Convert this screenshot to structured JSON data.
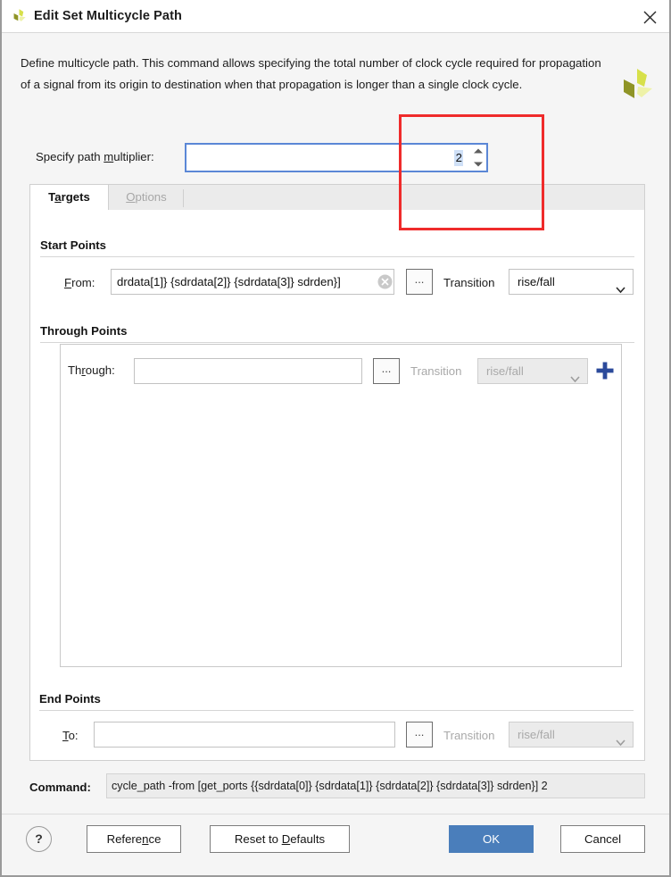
{
  "window": {
    "title": "Edit Set Multicycle Path",
    "icon": "vivado-logo-icon",
    "close_icon": "close-icon"
  },
  "description": "Define multicycle path. This command allows specifying the total number of clock cycle required for propagation of a signal from its origin to destination when that propagation is longer than a single clock cycle.",
  "brand": {
    "logo_icon": "xilinx-vivado-logo-icon",
    "colors": [
      "#d7e04a",
      "#8f9426",
      "#eef2a8"
    ]
  },
  "multiplier": {
    "label_before": "Specify path ",
    "label_mnemonic": "m",
    "label_after": "ultiplier:",
    "value": "2",
    "value_selected": true,
    "spin_up_icon": "spin-up-icon",
    "spin_down_icon": "spin-down-icon"
  },
  "annotation": {
    "color": "#ef2b2b",
    "shape": "rectangle"
  },
  "tabs": [
    {
      "label_before": "T",
      "label_mnemonic": "a",
      "label_after": "rgets",
      "label": "Targets",
      "active": true,
      "disabled": false
    },
    {
      "label_before": "",
      "label_mnemonic": "O",
      "label_after": "ptions",
      "label": "Options",
      "active": false,
      "disabled": true
    }
  ],
  "start_points": {
    "group_title": "Start Points",
    "from": {
      "label_before": "",
      "label_mnemonic": "F",
      "label_after": "rom:",
      "value": "drdata[1]} {sdrdata[2]} {sdrdata[3]} sdrden}]",
      "clear_icon": "clear-circle-icon",
      "browse_label": "...",
      "transition_label": "Transition",
      "transition_value": "rise/fall",
      "transition_disabled": false,
      "chevron_icon": "chevron-down-icon"
    }
  },
  "through_points": {
    "group_title": "Through Points",
    "through": {
      "label_before": "Th",
      "label_mnemonic": "r",
      "label_after": "ough:",
      "value": "",
      "browse_label": "...",
      "transition_label": "Transition",
      "transition_value": "rise/fall",
      "transition_disabled": true,
      "chevron_icon": "chevron-down-icon",
      "add_icon": "plus-icon"
    }
  },
  "end_points": {
    "group_title": "End Points",
    "to": {
      "label_before": "",
      "label_mnemonic": "T",
      "label_after": "o:",
      "value": "",
      "browse_label": "...",
      "transition_label": "Transition",
      "transition_value": "rise/fall",
      "transition_disabled": true,
      "chevron_icon": "chevron-down-icon"
    }
  },
  "command": {
    "label": "Command:",
    "value": "cycle_path -from [get_ports {{sdrdata[0]} {sdrdata[1]} {sdrdata[2]} {sdrdata[3]} sdrden}] 2"
  },
  "footer": {
    "help_icon": "?",
    "reference": {
      "before": "Refere",
      "mnemonic": "n",
      "after": "ce",
      "label": "Reference"
    },
    "reset": {
      "before": "Reset to ",
      "mnemonic": "D",
      "after": "efaults",
      "label": "Reset to Defaults"
    },
    "ok": {
      "label": "OK",
      "primary": true,
      "color": "#4a7ebb"
    },
    "cancel": {
      "label": "Cancel",
      "primary": false
    }
  }
}
